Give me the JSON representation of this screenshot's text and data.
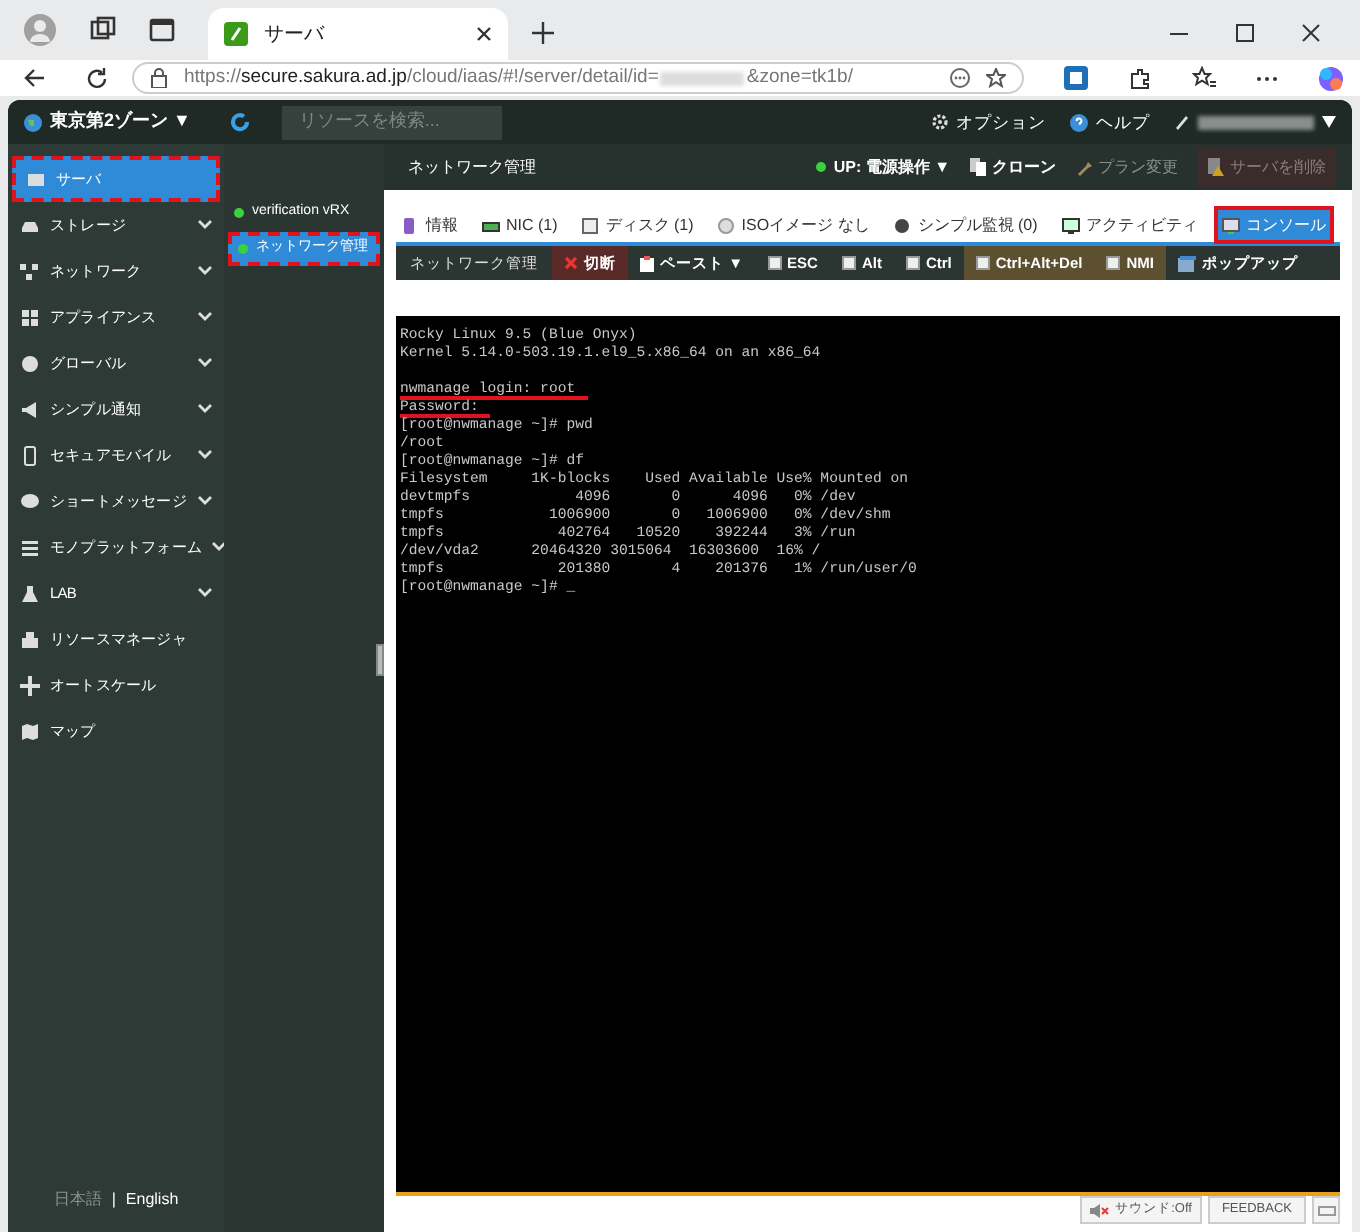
{
  "browser": {
    "tab_title": "サーバ",
    "url_prefix": "https://",
    "url_host": "secure.sakura.ad.jp",
    "url_path": "/cloud/iaas/#!/server/detail/id=",
    "url_suffix": "&zone=tk1b/"
  },
  "topbar": {
    "zone": "東京第2ゾーン ▼",
    "search_placeholder": "リソースを検索...",
    "options": "オプション",
    "help": "ヘルプ"
  },
  "sidebar": {
    "items": [
      {
        "label": "サーバ",
        "selected": true,
        "expandable": false
      },
      {
        "label": "ストレージ",
        "selected": false,
        "expandable": true
      },
      {
        "label": "ネットワーク",
        "selected": false,
        "expandable": true
      },
      {
        "label": "アプライアンス",
        "selected": false,
        "expandable": true
      },
      {
        "label": "グローバル",
        "selected": false,
        "expandable": true
      },
      {
        "label": "シンプル通知",
        "selected": false,
        "expandable": true
      },
      {
        "label": "セキュアモバイル",
        "selected": false,
        "expandable": true
      },
      {
        "label": "ショートメッセージ",
        "selected": false,
        "expandable": true
      },
      {
        "label": "モノプラットフォーム",
        "selected": false,
        "expandable": true
      },
      {
        "label": "LAB",
        "selected": false,
        "expandable": true
      },
      {
        "label": "リソースマネージャ",
        "selected": false,
        "expandable": false
      },
      {
        "label": "オートスケール",
        "selected": false,
        "expandable": false
      },
      {
        "label": "マップ",
        "selected": false,
        "expandable": false
      }
    ],
    "languages": [
      {
        "label": "日本語",
        "selected": true
      },
      {
        "label": "|",
        "selected": false
      },
      {
        "label": "English",
        "selected": false
      }
    ]
  },
  "servers": [
    {
      "label": "verification vRX",
      "selected": false
    },
    {
      "label": "ネットワーク管理",
      "selected": true
    }
  ],
  "server_header": {
    "title": "ネットワーク管理",
    "power": "UP: 電源操作 ▼",
    "clone": "クローン",
    "plan": "プラン変更",
    "delete": "サーバを削除"
  },
  "tabs": [
    {
      "label": "情報",
      "selected": false
    },
    {
      "label": "NIC (1)",
      "selected": false
    },
    {
      "label": "ディスク (1)",
      "selected": false
    },
    {
      "label": "ISOイメージ なし",
      "selected": false
    },
    {
      "label": "シンプル監視 (0)",
      "selected": false
    },
    {
      "label": "アクティビティ",
      "selected": false
    },
    {
      "label": "コンソール",
      "selected": true
    }
  ],
  "console_toolbar": [
    {
      "kind": "title",
      "label": "ネットワーク管理"
    },
    {
      "kind": "danger",
      "label": "切断"
    },
    {
      "kind": "menu",
      "label": "ペースト ▼"
    },
    {
      "kind": "check",
      "label": "ESC",
      "checked": false
    },
    {
      "kind": "check",
      "label": "Alt",
      "checked": false
    },
    {
      "kind": "check",
      "label": "Ctrl",
      "checked": false
    },
    {
      "kind": "key",
      "label": "Ctrl+Alt+Del"
    },
    {
      "kind": "key",
      "label": "NMI"
    },
    {
      "kind": "popup",
      "label": "ポップアップ"
    }
  ],
  "console_lines": [
    {
      "text": "Rocky Linux 9.5 (Blue Onyx)",
      "underlined": false
    },
    {
      "text": "Kernel 5.14.0-503.19.1.el9_5.x86_64 on an x86_64",
      "underlined": false
    },
    {
      "underlined": false
    },
    {
      "text": "nwmanage login: root",
      "underlined": true
    },
    {
      "text": "Password:",
      "underlined": true
    },
    {
      "text": "[root@nwmanage ~]# pwd",
      "underlined": false
    },
    {
      "text": "/root",
      "underlined": false
    },
    {
      "text": "[root@nwmanage ~]# df",
      "underlined": false
    },
    {
      "text": "Filesystem     1K-blocks    Used Available Use% Mounted on",
      "underlined": false
    },
    {
      "text": "devtmpfs            4096       0      4096   0% /dev",
      "underlined": false
    },
    {
      "text": "tmpfs            1006900       0   1006900   0% /dev/shm",
      "underlined": false
    },
    {
      "text": "tmpfs             402764   10520    392244   3% /run",
      "underlined": false
    },
    {
      "text": "/dev/vda2      20464320 3015064  16303600  16% /",
      "underlined": false
    },
    {
      "text": "tmpfs             201380       4    201376   1% /run/user/0",
      "underlined": false
    },
    {
      "text": "[root@nwmanage ~]# _",
      "underlined": false
    }
  ],
  "footer": {
    "sound": "サウンド:Off",
    "feedback": "FEEDBACK"
  }
}
